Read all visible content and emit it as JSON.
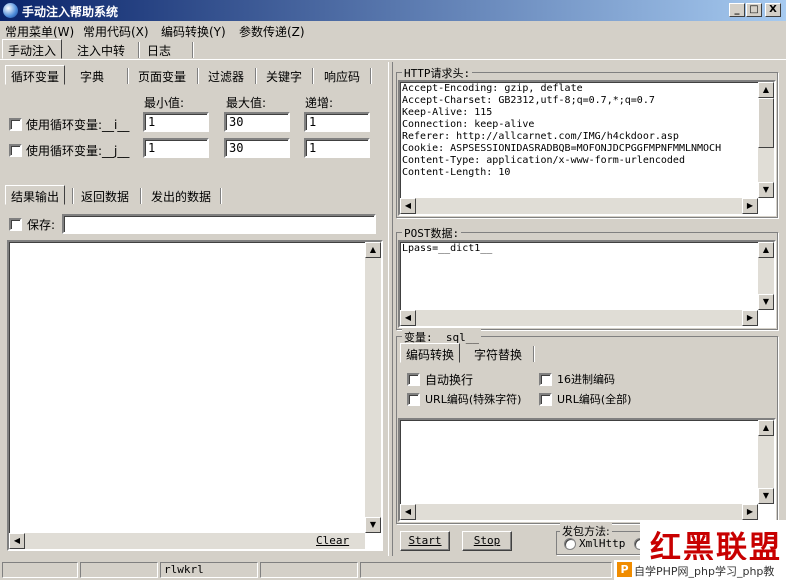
{
  "window": {
    "title": "手动注入帮助系统",
    "min_label": "_",
    "max_label": "□",
    "close_label": "X"
  },
  "menu": [
    "常用菜单(W)",
    "常用代码(X)",
    "编码转换(Y)",
    "参数传递(Z)"
  ],
  "main_tabs": [
    "手动注入",
    "注入中转",
    "日志"
  ],
  "var_tabs": [
    "循环变量",
    "字典",
    "页面变量",
    "过滤器",
    "关键字",
    "响应码"
  ],
  "loop": {
    "col_min": "最小值:",
    "col_max": "最大值:",
    "col_step": "递增:",
    "rows": [
      {
        "label": "使用循环变量:__i__",
        "min": "1",
        "max": "30",
        "step": "1"
      },
      {
        "label": "使用循环变量:__j__",
        "min": "1",
        "max": "30",
        "step": "1"
      }
    ]
  },
  "result_tabs": [
    "结果输出",
    "返回数据",
    "发出的数据"
  ],
  "save_label": "保存:",
  "save_value": "",
  "clear_label": "Clear",
  "http_header": {
    "label": "HTTP请求头:",
    "text": "Accept-Encoding: gzip, deflate\nAccept-Charset: GB2312,utf-8;q=0.7,*;q=0.7\nKeep-Alive: 115\nConnection: keep-alive\nReferer: http://allcarnet.com/IMG/h4ckdoor.asp\nCookie: ASPSESSIONIDASRADBQB=MOFONJDCPGGFMPNFMMLNMOCH\nContent-Type: application/x-www-form-urlencoded\nContent-Length: 10"
  },
  "post": {
    "label": "POST数据:",
    "text": "Lpass=__dict1__"
  },
  "variable": {
    "label": "变量:__sql__",
    "tabs": [
      "编码转换",
      "字符替换"
    ],
    "options": [
      "自动换行",
      "16进制编码",
      "URL编码(特殊字符)",
      "URL编码(全部)"
    ]
  },
  "buttons": {
    "start": "Start",
    "stop": "Stop"
  },
  "send_method": {
    "label": "发包方法:",
    "option1": "XmlHttp"
  },
  "status": {
    "panel3": "rlwkrl"
  },
  "watermarks": {
    "top": "红黑联盟",
    "bottom_icon": "P",
    "bottom": "自学PHP网_php学习_php教"
  },
  "colors": {
    "titlebar_start": "#0a246a",
    "titlebar_end": "#a6caf0",
    "window_bg": "#d4d0c8",
    "watermark_red": "#c80000"
  }
}
